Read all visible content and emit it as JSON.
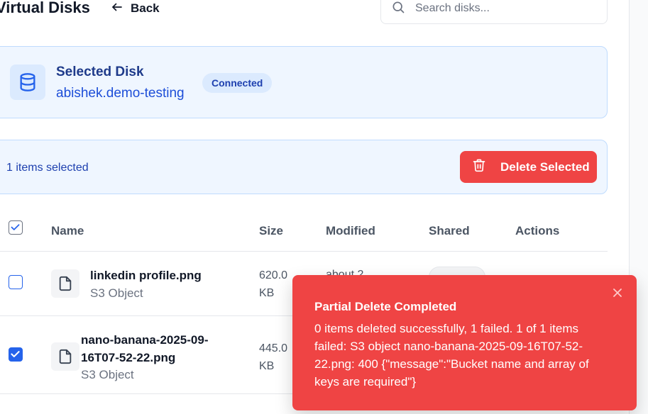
{
  "header": {
    "title": "Virtual Disks",
    "back_label": "Back",
    "search_placeholder": "Search disks..."
  },
  "selected_disk": {
    "label": "Selected Disk",
    "name": "abishek.demo-testing",
    "status": "Connected"
  },
  "selection_bar": {
    "count_text": "1 items selected",
    "delete_label": "Delete Selected"
  },
  "table": {
    "columns": [
      "Name",
      "Size",
      "Modified",
      "Shared",
      "Actions"
    ],
    "rows": [
      {
        "name": "linkedin profile.png",
        "type": "S3 Object",
        "size": "620.0 KB",
        "modified": "about 2",
        "checked": false
      },
      {
        "name": "nano-banana-2025-09-16T07-52-22.png",
        "type": "S3 Object",
        "size": "445.0 KB",
        "modified": "",
        "checked": true
      }
    ]
  },
  "toast": {
    "title": "Partial Delete Completed",
    "message": "0 items deleted successfully, 1 failed. 1 of 1 items failed: S3 object nano-banana-2025-09-16T07-52-22.png: 400 {\"message\":\"Bucket name and array of keys are required\"}"
  },
  "colors": {
    "accent": "#2563eb",
    "danger": "#ef4444",
    "card_bg": "#eff6ff"
  },
  "icons": {
    "back": "arrow-left-icon",
    "search": "search-icon",
    "disk": "database-icon",
    "delete": "trash-icon",
    "file": "file-icon",
    "close": "close-icon"
  }
}
